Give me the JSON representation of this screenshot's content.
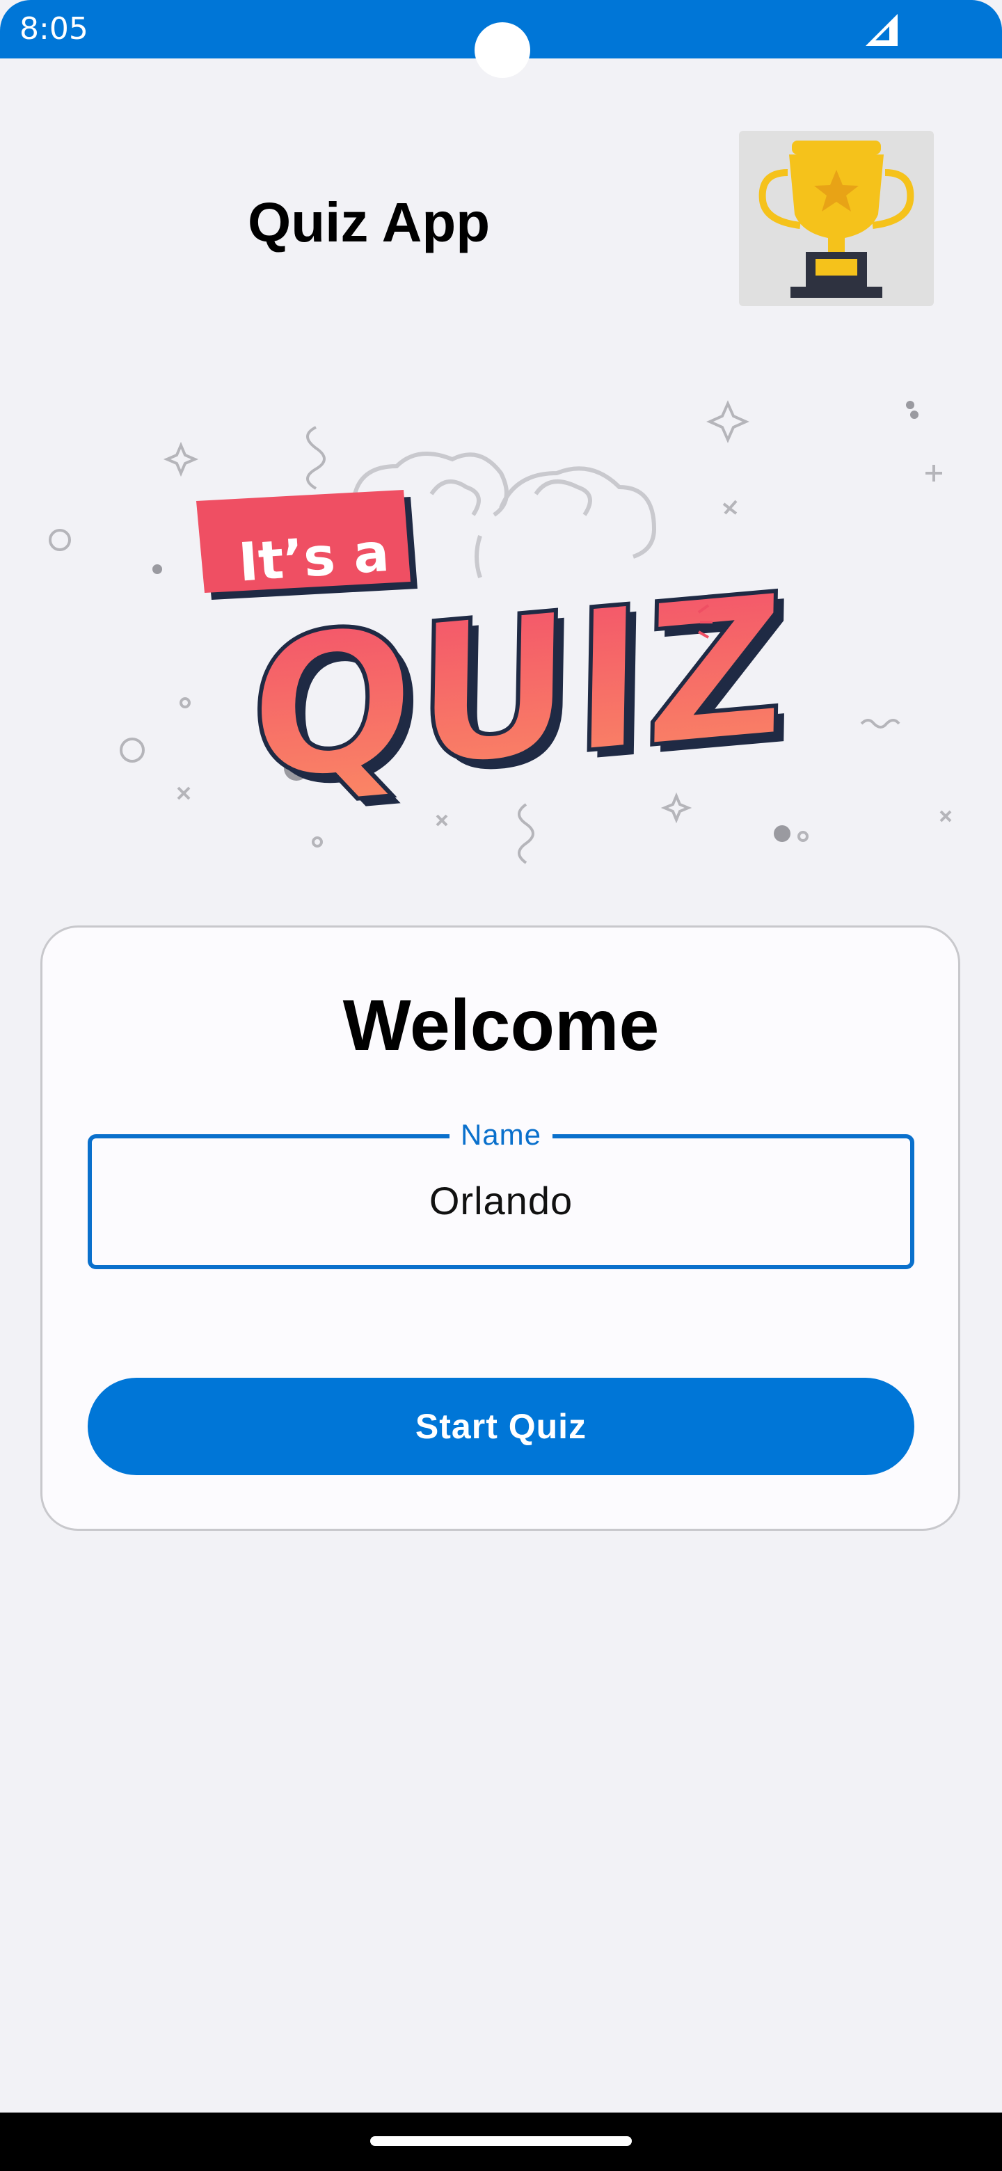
{
  "status_bar": {
    "time": "8:05",
    "signal_icon": "signal-icon",
    "background_color": "#0076d7"
  },
  "header": {
    "title": "Quiz App",
    "trophy_icon": "trophy-icon"
  },
  "hero": {
    "badge_text": "It’s a",
    "quiz_text": "QUIZ"
  },
  "card": {
    "title": "Welcome",
    "name_field": {
      "label": "Name",
      "value": "Orlando"
    },
    "start_button": "Start Quiz"
  },
  "colors": {
    "accent": "#0076d7",
    "badge": "#ef4f63",
    "quiz_gradient_top": "#f2506b",
    "quiz_gradient_bottom": "#fb8a64",
    "trophy_gold": "#f5c21b"
  }
}
